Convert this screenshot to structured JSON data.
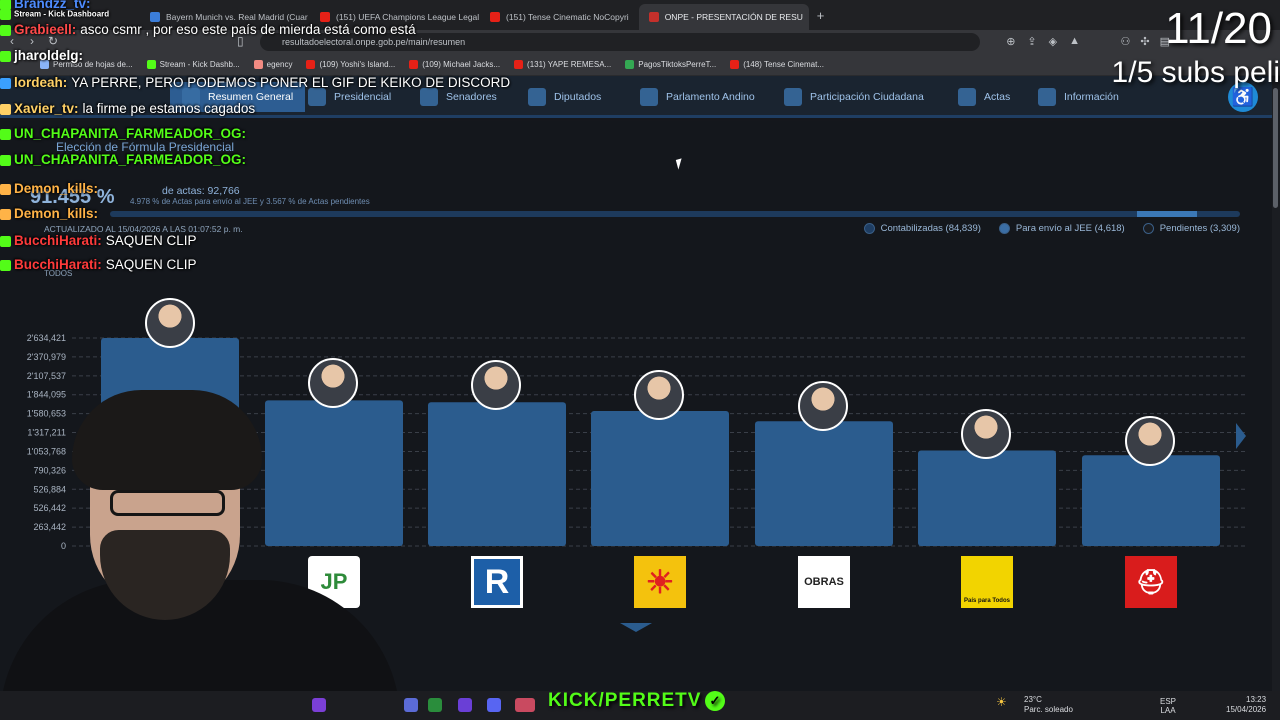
{
  "browser": {
    "tabs": [
      {
        "title": "Bayern Munich vs. Real Madrid (Cuar",
        "color": "#3b7dd8",
        "active": false
      },
      {
        "title": "(151) UEFA Champions League Legal",
        "color": "#e62117",
        "active": false
      },
      {
        "title": "(151) Tense Cinematic NoCopyri",
        "color": "#e62117",
        "active": false
      },
      {
        "title": "ONPE - PRESENTACIÓN DE RESU",
        "color": "#c4302b",
        "active": true
      }
    ],
    "new_tab": "+",
    "close_glyph": "×",
    "url": "resultadoelectoral.onpe.gob.pe/main/resumen",
    "bookmarks": [
      {
        "label": "Permiso de hojas de...",
        "color": "#8ab4f8"
      },
      {
        "label": "Stream - Kick Dashb...",
        "color": "#53fc18"
      },
      {
        "label": "egency",
        "color": "#f28b82"
      },
      {
        "label": "(109) Yoshi's Island...",
        "color": "#e62117"
      },
      {
        "label": "(109) Michael Jacks...",
        "color": "#e62117"
      },
      {
        "label": "(131) YAPE REMESA...",
        "color": "#e62117"
      },
      {
        "label": "PagosTiktoksPerreT...",
        "color": "#34a853"
      },
      {
        "label": "(148) Tense Cinemat...",
        "color": "#e62117"
      }
    ]
  },
  "onpe": {
    "nav": [
      {
        "label": "Resumen General",
        "active": true
      },
      {
        "label": "Presidencial",
        "active": false
      },
      {
        "label": "Senadores",
        "active": false
      },
      {
        "label": "Diputados",
        "active": false
      },
      {
        "label": "Parlamento Andino",
        "active": false
      },
      {
        "label": "Participación Ciudadana",
        "active": false
      },
      {
        "label": "Actas",
        "active": false
      },
      {
        "label": "Información",
        "active": false
      }
    ],
    "election_title": "Elección de Fórmula Presidencial",
    "actas_text": "de actas: 92,766",
    "percent": "91.455 %",
    "subline": "4.978 % de Actas para envío al JEE y 3.567 % de Actas pendientes",
    "updated": "ACTUALIZADO AL 15/04/2026 A LAS 01:07:52 p. m.",
    "legend": [
      {
        "label": "Contabilizadas (84,839)",
        "fill": "#1f3e63"
      },
      {
        "label": "Para envío al JEE (4,618)",
        "fill": "#3b6ea5"
      },
      {
        "label": "Pendientes (3,309)",
        "fill": "#1a1d22"
      }
    ],
    "filter": "TODOS"
  },
  "chart_data": {
    "type": "bar",
    "y_ticks": [
      "2'634,421",
      "2'370,979",
      "2'107,537",
      "1'844,095",
      "1'580,653",
      "1'317,211",
      "1'053,768",
      "790,326",
      "526,884",
      "526,442",
      "263,442",
      "0"
    ],
    "ylim": [
      0,
      2634421
    ],
    "values": [
      2634421,
      1844095,
      1820000,
      1710000,
      1580000,
      1210000,
      1150000
    ],
    "bar_color": "#2b5c8e",
    "parties": [
      "",
      "JP",
      "R",
      "",
      "OBRAS",
      "País para Todos",
      "Podemos"
    ]
  },
  "overlay": {
    "chat": [
      {
        "user": "Brandzz_tv:",
        "text": "",
        "color": "#4e8cff"
      },
      {
        "user": "Stream - Kick Dashboard",
        "text": "",
        "color": "#ffffff"
      },
      {
        "user": "Grabieell:",
        "text": "asco csmr , por eso este país de mierda está como está",
        "color": "#ff4a4a"
      },
      {
        "user": "jharoldelg:",
        "text": "",
        "color": "#ffffff"
      },
      {
        "user": "lordeah:",
        "text": "YA PERRE, PERO PODEMOS PONER EL GIF DE KEIKO DE DISCORD",
        "color": "#ffd166"
      },
      {
        "user": "Xavier_tv:",
        "text": "la firme pe estamos cagados",
        "color": "#ffd166"
      },
      {
        "user": "UN_CHAPANITA_FARMEADOR_OG:",
        "text": "",
        "color": "#53fc18"
      },
      {
        "user": "UN_CHAPANITA_FARMEADOR_OG:",
        "text": "",
        "color": "#53fc18"
      },
      {
        "user": "Demon_kills:",
        "text": "",
        "color": "#ffb347"
      },
      {
        "user": "Demon_kills:",
        "text": "",
        "color": "#ffb347"
      },
      {
        "user": "BucchiHarati:",
        "text": "SAQUEN CLIP",
        "color": "#ff3b3b"
      },
      {
        "user": "BucchiHarati:",
        "text": "SAQUEN CLIP",
        "color": "#ff3b3b"
      }
    ],
    "counter": "11/20",
    "subs_text": "1/5 subs peli",
    "kick_brand": "KICK/PERRETV",
    "check_glyph": "✓"
  },
  "taskbar": {
    "weather_temp": "23°C",
    "weather_desc": "Parc. soleado",
    "lang1": "ESP",
    "lang2": "LAA",
    "time": "13:23",
    "date": "15/04/2026"
  }
}
